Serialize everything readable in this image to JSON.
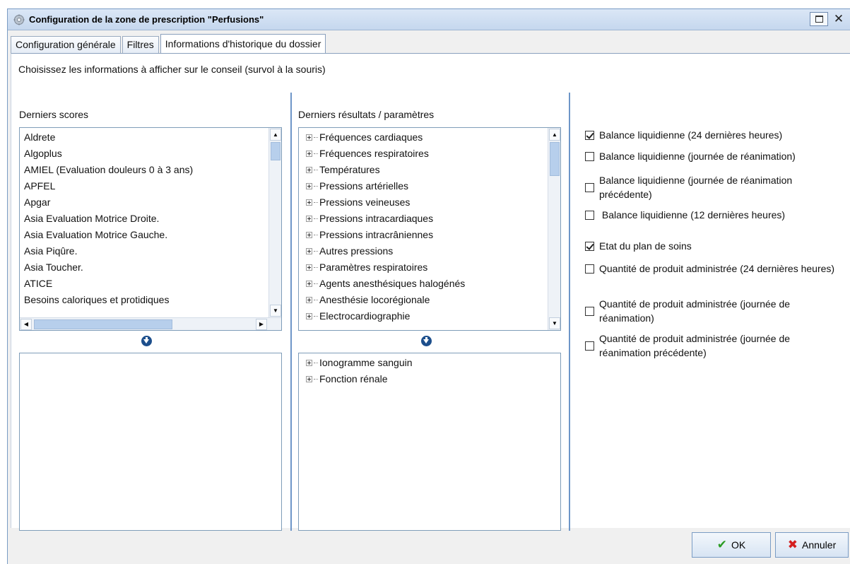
{
  "window": {
    "title": "Configuration de la zone de prescription \"Perfusions\"",
    "icon": "gear-icon",
    "maximize_icon": "maximize-icon",
    "close_glyph": "✕"
  },
  "tabs": [
    {
      "label": "Configuration générale"
    },
    {
      "label": "Filtres"
    },
    {
      "label": "Informations d'historique du dossier"
    }
  ],
  "active_tab": 2,
  "instruction": "Choisissez les informations à afficher sur le conseil (survol à la souris)",
  "scores": {
    "title": "Derniers scores",
    "items": [
      "Aldrete",
      "Algoplus",
      "AMIEL (Evaluation douleurs 0 à 3 ans)",
      "APFEL",
      "Apgar",
      "Asia Evaluation Motrice Droite.",
      "Asia Evaluation Motrice Gauche.",
      "Asia Piqûre.",
      "Asia Toucher.",
      "ATICE",
      "Besoins caloriques et protidiques"
    ],
    "selected": []
  },
  "results": {
    "title": "Derniers résultats / paramètres",
    "items": [
      "Fréquences cardiaques",
      "Fréquences respiratoires",
      "Températures",
      "Pressions artérielles",
      "Pressions veineuses",
      "Pressions intracardiaques",
      "Pressions intracrâniennes",
      "Autres pressions",
      "Paramètres respiratoires",
      "Agents anesthésiques halogénés",
      "Anesthésie locorégionale",
      "Electrocardiographie"
    ],
    "selected": [
      "Ionogramme sanguin",
      "Fonction rénale"
    ]
  },
  "options": [
    {
      "label": "Balance liquidienne (24 dernières heures)",
      "checked": true
    },
    {
      "label": "Balance liquidienne (journée de réanimation)",
      "checked": false
    },
    {
      "label": "Balance liquidienne (journée de réanimation précédente)",
      "checked": false
    },
    {
      "label": " Balance liquidienne (12 dernières heures)",
      "checked": false
    },
    {
      "label": "Etat du plan de soins",
      "checked": true
    },
    {
      "label": "Quantité de produit administrée (24 dernières heures)",
      "checked": false
    },
    {
      "label": "Quantité de produit administrée (journée de réanimation)",
      "checked": false
    },
    {
      "label": "Quantité de produit administrée (journée de réanimation précédente)",
      "checked": false
    }
  ],
  "buttons": {
    "ok_label": "OK",
    "cancel_label": "Annuler"
  },
  "colors": {
    "accent": "#6e96c8",
    "ok_icon": "#2c9c24",
    "cancel_icon": "#d42020"
  }
}
